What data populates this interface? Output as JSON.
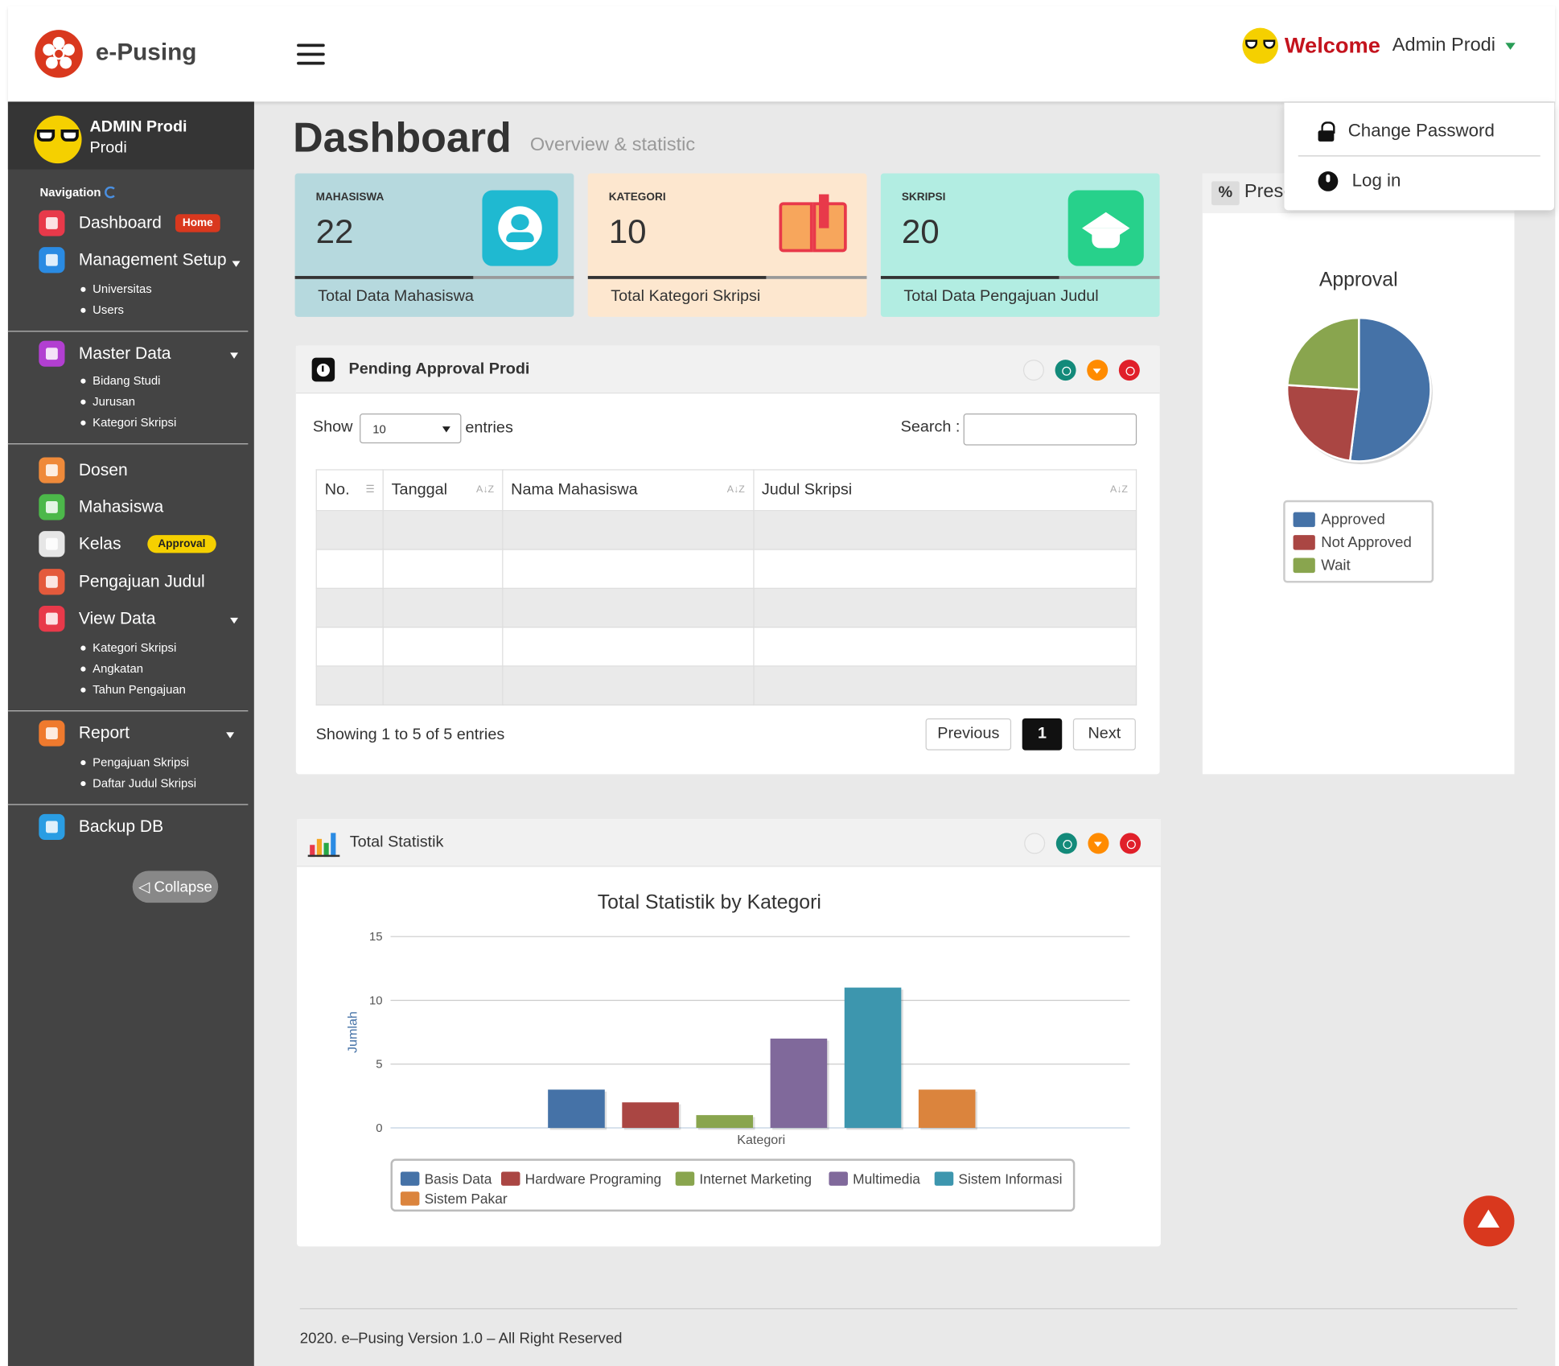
{
  "brand": "e-Pusing",
  "header": {
    "welcome": "Welcome",
    "user_name": "Admin Prodi"
  },
  "user_menu": {
    "change_password": "Change Password",
    "login": "Log in"
  },
  "sidebar": {
    "user_title": "ADMIN Prodi",
    "user_role": "Prodi",
    "nav_title": "Navigation",
    "dashboard": "Dashboard",
    "dashboard_badge": "Home",
    "management": "Management Setup",
    "management_subs": [
      "Universitas",
      "Users"
    ],
    "master": "Master Data",
    "master_subs": [
      "Bidang Studi",
      "Jurusan",
      "Kategori Skripsi"
    ],
    "dosen": "Dosen",
    "mahasiswa": "Mahasiswa",
    "kelas": "Kelas",
    "kelas_badge": "Approval",
    "pengajuan": "Pengajuan Judul",
    "viewdata": "View Data",
    "viewdata_subs": [
      "Kategori Skripsi",
      "Angkatan",
      "Tahun Pengajuan"
    ],
    "report": "Report",
    "report_subs": [
      "Pengajuan Skripsi",
      "Daftar Judul Skripsi"
    ],
    "backup": "Backup DB",
    "collapse": "◁ Collapse"
  },
  "page": {
    "title": "Dashboard",
    "subtitle": "Overview & statistic"
  },
  "stats": [
    {
      "label": "MAHASISWA",
      "value": "22",
      "footer": "Total Data Mahasiswa"
    },
    {
      "label": "KATEGORI",
      "value": "10",
      "footer": "Total Kategori Skripsi"
    },
    {
      "label": "SKRIPSI",
      "value": "20",
      "footer": "Total Data Pengajuan Judul"
    }
  ],
  "pending": {
    "title": "Pending Approval Prodi",
    "show": "Show",
    "length_value": "10",
    "entries": "entries",
    "search_label": "Search :",
    "columns": [
      "No.",
      "Tanggal",
      "Nama Mahasiswa",
      "Judul Skripsi"
    ],
    "info": "Showing 1 to 5 of 5 entries",
    "prev": "Previous",
    "page": "1",
    "next": "Next"
  },
  "presentase": {
    "title_visible": "Prese"
  },
  "approval_chart": {
    "type": "pie",
    "title": "Approval",
    "series": [
      {
        "name": "Approved",
        "value": 52,
        "color": "#4572a7"
      },
      {
        "name": "Not Approved",
        "value": 24,
        "color": "#aa4643"
      },
      {
        "name": "Wait",
        "value": 24,
        "color": "#89a54e"
      }
    ]
  },
  "statistik_panel": {
    "title": "Total Statistik"
  },
  "chart_data": {
    "type": "bar",
    "title": "Total Statistik by Kategori",
    "xlabel": "Kategori",
    "ylabel": "Jumlah",
    "ylim": [
      0,
      15
    ],
    "yticks": [
      0,
      5,
      10,
      15
    ],
    "grid": true,
    "legend": "bottom",
    "series": [
      {
        "name": "Basis Data",
        "value": 3,
        "color": "#4572a7"
      },
      {
        "name": "Hardware Programing",
        "value": 2,
        "color": "#aa4643"
      },
      {
        "name": "Internet Marketing",
        "value": 1,
        "color": "#89a54e"
      },
      {
        "name": "Multimedia",
        "value": 7,
        "color": "#80699b"
      },
      {
        "name": "Sistem Informasi",
        "value": 11,
        "color": "#3d96ae"
      },
      {
        "name": "Sistem Pakar",
        "value": 3,
        "color": "#db843d"
      }
    ]
  },
  "footer": "2020. e–Pusing Version 1.0 – All Right Reserved"
}
